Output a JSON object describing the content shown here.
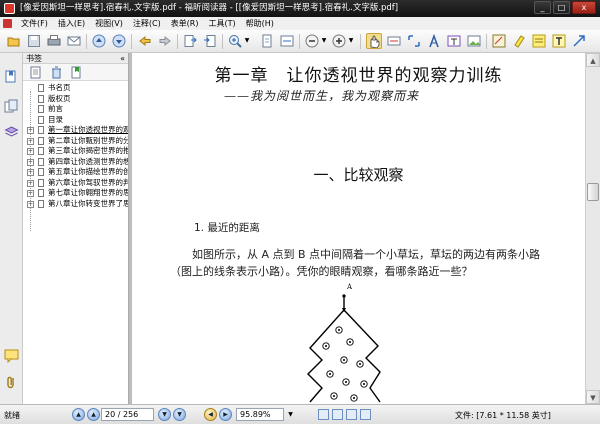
{
  "window": {
    "title": "[像爱因斯坦一样思考].宿春礼.文字版.pdf - 福昕阅读器 - [[像爱因斯坦一样思考].宿春礼.文字版.pdf]",
    "minimize": "_",
    "maximize": "□",
    "close": "x"
  },
  "menu": {
    "items": [
      "文件(F)",
      "插入(E)",
      "视图(V)",
      "注释(C)",
      "表单(R)",
      "工具(T)",
      "帮助(H)"
    ]
  },
  "toolbar": {
    "icons": [
      "open-icon",
      "save-icon",
      "print-icon",
      "email-icon",
      "previous-page-icon",
      "next-page-icon",
      "back-icon",
      "forward-icon",
      "extract-page-icon",
      "insert-page-icon",
      "zoom-in-tool-icon",
      "fit-page-icon",
      "fit-width-icon",
      "zoom-out-icon",
      "zoom-in-icon",
      "hand-tool-icon",
      "select-text-icon",
      "snapshot-icon",
      "typewriter-icon",
      "text-box-icon",
      "image-icon",
      "callout-icon",
      "highlight-icon",
      "note-icon",
      "text-icon",
      "arrow-icon"
    ]
  },
  "sidebar": {
    "header": "书签",
    "collapse": "«",
    "bookmarks": [
      {
        "label": "书名页",
        "expandable": false
      },
      {
        "label": "版权页",
        "expandable": false
      },
      {
        "label": "前言",
        "expandable": false
      },
      {
        "label": "目录",
        "expandable": false
      },
      {
        "label": "第一章让你透视世界的观察力训练",
        "expandable": true
      },
      {
        "label": "第二章让你甄别世界的分析力训练",
        "expandable": true
      },
      {
        "label": "第三章让你揭密世界的推理力训练",
        "expandable": true
      },
      {
        "label": "第四章让你透测世界的想象力训练",
        "expandable": true
      },
      {
        "label": "第五章让你描绘世界的创造力训练",
        "expandable": true
      },
      {
        "label": "第六章让你驾驭世界的判断力训练",
        "expandable": true
      },
      {
        "label": "第七章让你翱翔世界的思维力训练",
        "expandable": true
      },
      {
        "label": "第八章让你转变世界了思维方式训练",
        "expandable": true
      }
    ]
  },
  "document": {
    "chapter_title": "第一章　让你透视世界的观察力训练",
    "chapter_subtitle": "——我为阅世而生，我为观察而来",
    "section_title": "一、比较观察",
    "subsection_title": "1. 最近的距离",
    "paragraph": "如图所示，从 A 点到 B 点中间隔着一个小草坛，草坛的两边有两条小路（图上的线条表示小路）。凭你的眼睛观察，看哪条路近一些？",
    "figure_label_a": "A"
  },
  "statusbar": {
    "ready": "就绪",
    "page": "20 / 256",
    "zoom": "95.89%",
    "file_info": "文件: [7.61 * 11.58 英寸]"
  }
}
